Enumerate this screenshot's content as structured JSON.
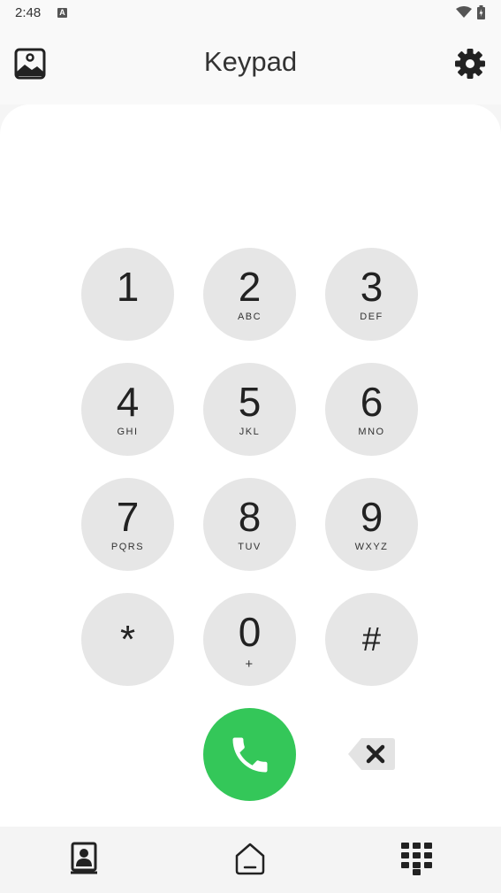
{
  "status_bar": {
    "time": "2:48",
    "notification_icon": "a-icon",
    "wifi_icon": "wifi-icon",
    "battery_icon": "battery-icon"
  },
  "header": {
    "title": "Keypad",
    "left_icon": "gallery-icon",
    "right_icon": "settings-gear-icon"
  },
  "dialer": {
    "number": "",
    "keys": [
      {
        "digit": "1",
        "letters": ""
      },
      {
        "digit": "2",
        "letters": "ABC"
      },
      {
        "digit": "3",
        "letters": "DEF"
      },
      {
        "digit": "4",
        "letters": "GHI"
      },
      {
        "digit": "5",
        "letters": "JKL"
      },
      {
        "digit": "6",
        "letters": "MNO"
      },
      {
        "digit": "7",
        "letters": "PQRS"
      },
      {
        "digit": "8",
        "letters": "TUV"
      },
      {
        "digit": "9",
        "letters": "WXYZ"
      },
      {
        "digit": "*",
        "letters": ""
      },
      {
        "digit": "0",
        "letters": "+"
      },
      {
        "digit": "#",
        "letters": ""
      }
    ],
    "call_icon": "phone-icon",
    "delete_icon": "backspace-icon"
  },
  "bottom_nav": {
    "items": [
      {
        "icon": "contacts-icon"
      },
      {
        "icon": "home-icon"
      },
      {
        "icon": "dialpad-icon"
      }
    ]
  },
  "colors": {
    "call_green": "#34c759",
    "key_gray": "#e6e6e6",
    "background": "#f5f5f5"
  }
}
